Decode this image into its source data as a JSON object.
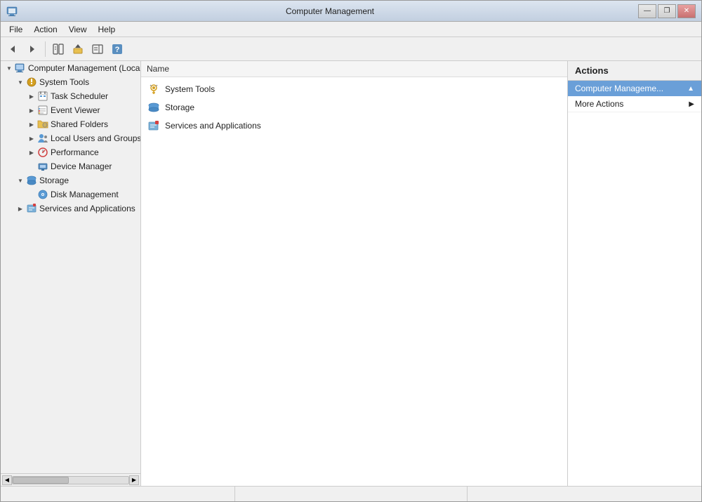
{
  "window": {
    "title": "Computer Management",
    "controls": {
      "minimize": "—",
      "restore": "❐",
      "close": "✕"
    }
  },
  "menu": {
    "items": [
      "File",
      "Action",
      "View",
      "Help"
    ]
  },
  "toolbar": {
    "buttons": [
      "◀",
      "▶",
      "⬆",
      "⬇",
      "❓"
    ]
  },
  "tree": {
    "root": "Computer Management (Local",
    "items": [
      {
        "label": "System Tools",
        "level": 2,
        "expanded": true,
        "icon": "tools"
      },
      {
        "label": "Task Scheduler",
        "level": 3,
        "expanded": false,
        "icon": "calendar"
      },
      {
        "label": "Event Viewer",
        "level": 3,
        "expanded": false,
        "icon": "log"
      },
      {
        "label": "Shared Folders",
        "level": 3,
        "expanded": false,
        "icon": "folder"
      },
      {
        "label": "Local Users and Groups",
        "level": 3,
        "expanded": false,
        "icon": "users"
      },
      {
        "label": "Performance",
        "level": 3,
        "expanded": false,
        "icon": "perf"
      },
      {
        "label": "Device Manager",
        "level": 3,
        "expanded": false,
        "icon": "device"
      },
      {
        "label": "Storage",
        "level": 2,
        "expanded": true,
        "icon": "storage"
      },
      {
        "label": "Disk Management",
        "level": 3,
        "expanded": false,
        "icon": "disk"
      },
      {
        "label": "Services and Applications",
        "level": 2,
        "expanded": false,
        "icon": "services"
      }
    ]
  },
  "content": {
    "header": "Name",
    "items": [
      {
        "label": "System Tools",
        "icon": "tools"
      },
      {
        "label": "Storage",
        "icon": "storage"
      },
      {
        "label": "Services and Applications",
        "icon": "services"
      }
    ]
  },
  "actions": {
    "header": "Actions",
    "section_title": "Computer Manageme...",
    "items": [
      {
        "label": "More Actions",
        "has_arrow": true
      }
    ]
  },
  "status": {
    "sections": [
      "",
      "",
      ""
    ]
  }
}
